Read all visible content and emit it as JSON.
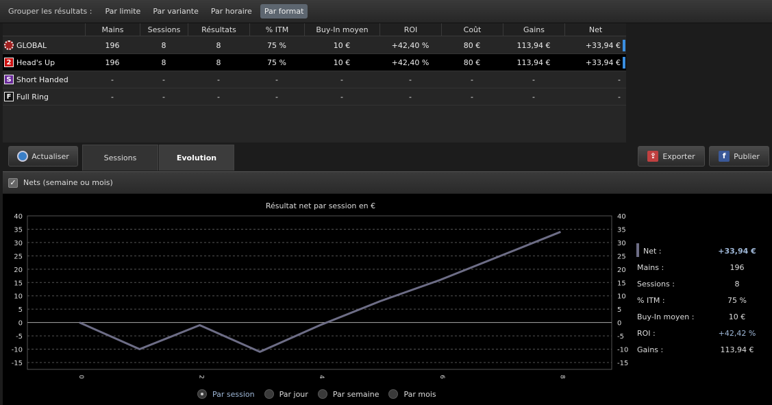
{
  "toolbar": {
    "group_label": "Grouper les résultats :",
    "groups": [
      "Par limite",
      "Par variante",
      "Par horaire",
      "Par format"
    ],
    "active_group": "Par format"
  },
  "table": {
    "headers": [
      "Mains",
      "Sessions",
      "Résultats",
      "% ITM",
      "Buy-In moyen",
      "ROI",
      "Coût",
      "Gains",
      "Net"
    ],
    "rows": [
      {
        "icon": "poker-chip-icon",
        "icon_text": "",
        "name": "GLOBAL",
        "cells": [
          "196",
          "8",
          "8",
          "75 %",
          "10 €",
          "+42,40 %",
          "80 €",
          "113,94 €",
          "+33,94 €"
        ]
      },
      {
        "icon": "number-2-icon",
        "icon_text": "2",
        "name": "Head's Up",
        "cells": [
          "196",
          "8",
          "8",
          "75 %",
          "10 €",
          "+42,40 %",
          "80 €",
          "113,94 €",
          "+33,94 €"
        ]
      },
      {
        "icon": "letter-s-icon",
        "icon_text": "S",
        "name": "Short Handed",
        "cells": [
          "-",
          "-",
          "-",
          "-",
          "-",
          "-",
          "-",
          "-",
          "-"
        ]
      },
      {
        "icon": "letter-f-icon",
        "icon_text": "F",
        "name": "Full Ring",
        "cells": [
          "-",
          "-",
          "-",
          "-",
          "-",
          "-",
          "-",
          "-",
          "-"
        ]
      }
    ]
  },
  "actions": {
    "refresh": "Actualiser",
    "tab_sessions": "Sessions",
    "tab_evolution": "Evolution",
    "export": "Exporter",
    "publish": "Publier",
    "publish_icon_text": "f"
  },
  "option": {
    "checkbox_label": "Nets (semaine ou mois)",
    "checked": true
  },
  "chart_data": {
    "type": "line",
    "title": "Résultat net par session en €",
    "x": [
      "0",
      "1",
      "2",
      "3",
      "4",
      "5",
      "6",
      "7",
      "8"
    ],
    "x_tick_labels": [
      "0",
      "2",
      "4",
      "6",
      "8"
    ],
    "series": [
      {
        "name": "Net",
        "values": [
          0,
          -10,
          -1,
          -11,
          -1,
          8,
          16,
          25,
          34
        ],
        "color": "#6d6d86"
      }
    ],
    "ylim": [
      -15,
      40
    ],
    "yticks": [
      -15,
      -10,
      -5,
      0,
      5,
      10,
      15,
      20,
      25,
      30,
      35,
      40
    ],
    "grid": true
  },
  "stats": [
    {
      "label": "Net :",
      "value": "+33,94 €"
    },
    {
      "label": "Mains :",
      "value": "196"
    },
    {
      "label": "Sessions :",
      "value": "8"
    },
    {
      "label": "% ITM :",
      "value": "75 %"
    },
    {
      "label": "Buy-In moyen :",
      "value": "10 €"
    },
    {
      "label": "ROI :",
      "value": "+42,42 %"
    },
    {
      "label": "Gains :",
      "value": "113,94 €"
    }
  ],
  "radios": [
    "Par session",
    "Par jour",
    "Par semaine",
    "Par mois"
  ],
  "radio_selected": "Par session",
  "colors": {
    "accent_bar": "#3a8ee0",
    "line": "#6d6d86",
    "net_value": "#9fb8d8"
  }
}
